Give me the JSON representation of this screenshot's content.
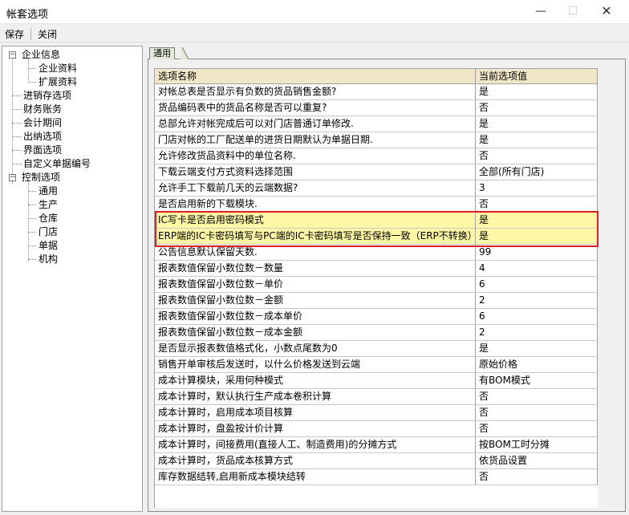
{
  "window": {
    "title": "帐套选项",
    "minimize": "—",
    "maximize": "☐",
    "close": "✕"
  },
  "toolbar": {
    "save_label": "保存",
    "close_label": "关闭"
  },
  "tree": {
    "items": [
      {
        "label": "企业信息",
        "expander": "−"
      },
      {
        "label": "企业资料"
      },
      {
        "label": "扩展资料"
      },
      {
        "label": "进销存选项"
      },
      {
        "label": "财务账务"
      },
      {
        "label": "会计期间"
      },
      {
        "label": "出纳选项"
      },
      {
        "label": "界面选项"
      },
      {
        "label": "自定义单据编号"
      },
      {
        "label": "控制选项",
        "expander": "−"
      },
      {
        "label": "通用"
      },
      {
        "label": "生产"
      },
      {
        "label": "仓库"
      },
      {
        "label": "门店"
      },
      {
        "label": "单据"
      },
      {
        "label": "机构"
      }
    ]
  },
  "tab": {
    "label": "通用"
  },
  "grid": {
    "columns": [
      "选项名称",
      "当前选项值"
    ],
    "rows": [
      {
        "name": "对帐总表是否显示有负数的货品销售金额?",
        "value": "是"
      },
      {
        "name": "货品编码表中的货品名称是否可以重复?",
        "value": "否"
      },
      {
        "name": "总部允许对帐完成后可以对门店普通订单修改.",
        "value": "是"
      },
      {
        "name": "门店对帐的工厂配送单的进货日期默认为单据日期.",
        "value": "是"
      },
      {
        "name": "允许修改货品资料中的单位名称.",
        "value": "否"
      },
      {
        "name": "下载云端支付方式资料选择范围",
        "value": "全部(所有门店)"
      },
      {
        "name": "允许手工下载前几天的云端数据?",
        "value": "3"
      },
      {
        "name": "是否启用新的下载模块.",
        "value": "否"
      },
      {
        "name": "IC写卡是否启用密码模式",
        "value": "是"
      },
      {
        "name": "ERP端的IC卡密码填写与PC端的IC卡密码填写是否保持一致（ERP不转换）",
        "value": "是"
      },
      {
        "name": "公告信息默认保留天数.",
        "value": "99"
      },
      {
        "name": "报表数值保留小数位数－数量",
        "value": "4"
      },
      {
        "name": "报表数值保留小数位数－单价",
        "value": "6"
      },
      {
        "name": "报表数值保留小数位数－金额",
        "value": "2"
      },
      {
        "name": "报表数值保留小数位数－成本单价",
        "value": "6"
      },
      {
        "name": "报表数值保留小数位数－成本金额",
        "value": "2"
      },
      {
        "name": "是否显示报表数值格式化，小数点尾数为0",
        "value": "是"
      },
      {
        "name": "销售开单审核后发送时，以什么价格发送到云端",
        "value": "原始价格"
      },
      {
        "name": "成本计算模块，采用何种模式",
        "value": "有BOM模式"
      },
      {
        "name": "成本计算时，默认执行生产成本卷积计算",
        "value": "否"
      },
      {
        "name": "成本计算时，启用成本项目核算",
        "value": "否"
      },
      {
        "name": "成本计算时，盘盈按计价计算",
        "value": "否"
      },
      {
        "name": "成本计算时，间接费用(直接人工、制造费用)的分摊方式",
        "value": "按BOM工时分摊"
      },
      {
        "name": "成本计算时，货品成本核算方式",
        "value": "依货品设置"
      },
      {
        "name": "库存数据结转,启用新成本模块结转",
        "value": "否"
      }
    ],
    "highlighted_rows": [
      8,
      9
    ]
  },
  "colors": {
    "header_bg": "#f2e6c9",
    "highlight_bg": "#fdf7a6",
    "annotation_border": "#e02020"
  }
}
